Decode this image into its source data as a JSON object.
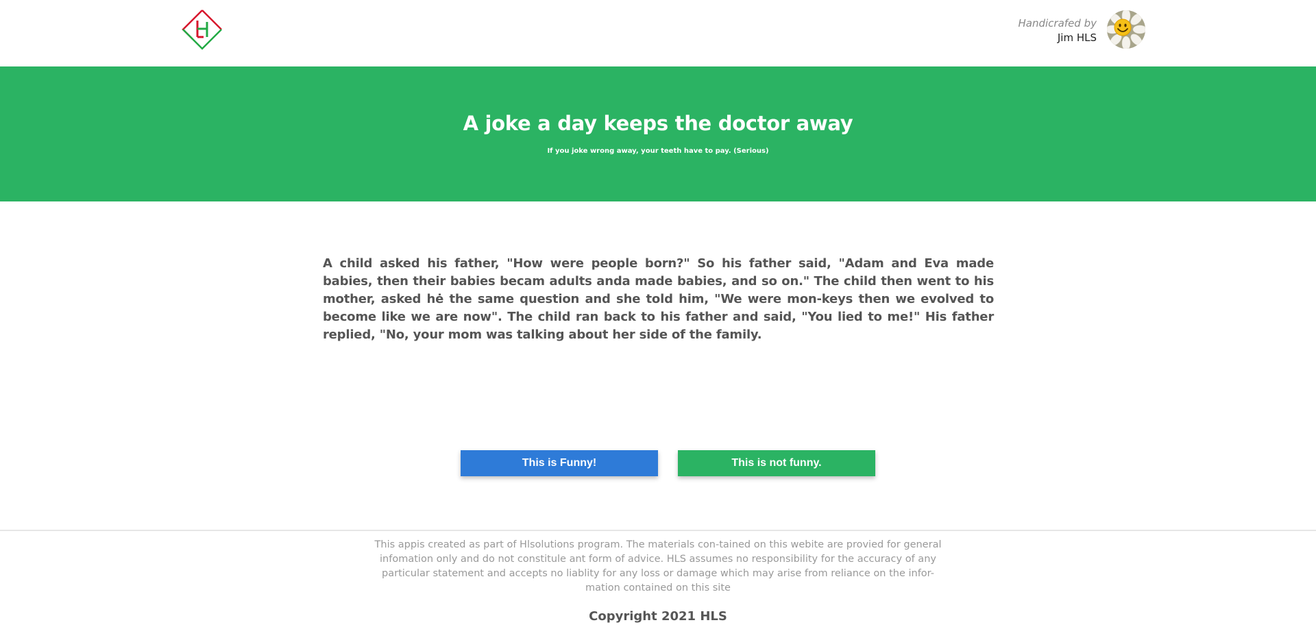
{
  "header": {
    "logo_letters": "HL",
    "author_prefix": "Handicrafed by",
    "author_name": "Jim HLS",
    "avatar_icon": "daisy-smiley-icon"
  },
  "hero": {
    "title": "A joke a day keeps the doctor away",
    "subtitle": "If you joke wrong away, your teeth have to pay. (Serious)",
    "background_color": "#2bb363"
  },
  "joke": {
    "text": "A child asked his father, \"How were people born?\" So his father said, \"Adam and Eva made babies, then their babies becam adults anda made babies, and so on.\" The child then went to his mother, asked hė the same question and she told him, \"We were mon-keys then we evolved to become like we are now\". The child ran back to his father and said, \"You lied to me!\" His father replied, \"No, your mom was talking about her side of the family."
  },
  "buttons": {
    "funny_label": "This is Funny!",
    "funny_color": "#2e7bd8",
    "not_funny_label": "This is not funny.",
    "not_funny_color": "#2bb363"
  },
  "footer": {
    "disclaimer": "This appis created as part of Hlsolutions program. The materials con-tained on this webite are provied for general infomation only and do not constitule ant form of advice. HLS assumes no responsibility for the accuracy of any particular statement and accepts no liablity for any loss or damage which may arise from reliance on the infor-mation contained on this site",
    "copyright": "Copyright 2021 HLS"
  }
}
